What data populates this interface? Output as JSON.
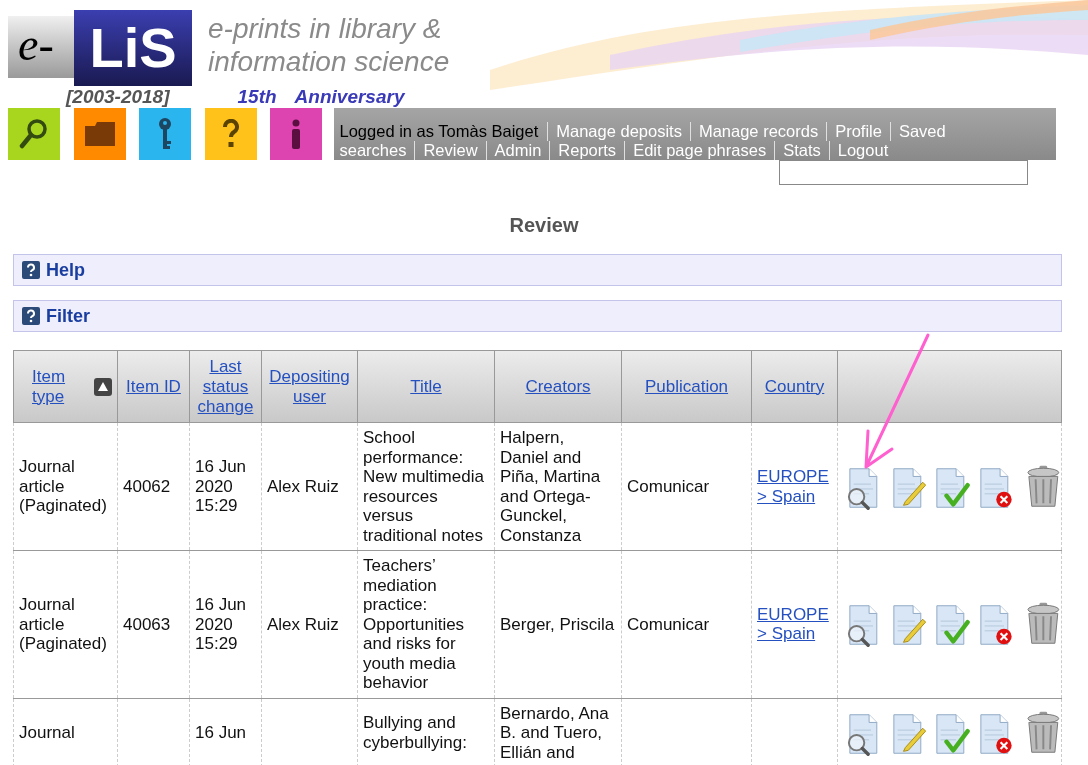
{
  "logo": {
    "prefix": "e-",
    "name": "LiS",
    "years": "[2003-2018]",
    "tagline": [
      "e-prints in library &",
      "information science"
    ],
    "anniversary": [
      "15th",
      "Anniversary"
    ]
  },
  "toolbar": [
    {
      "kind": "search",
      "color": "#a8d61e"
    },
    {
      "kind": "folder",
      "color": "#ff8a00"
    },
    {
      "kind": "key",
      "color": "#2bb5ee"
    },
    {
      "kind": "help",
      "color": "#ffc21a"
    },
    {
      "kind": "info",
      "color": "#dd44b0"
    }
  ],
  "user_nav": {
    "logged_in": "Logged in as Tomàs Baiget",
    "lines": [
      [
        "Manage deposits",
        "Manage records",
        "Profile",
        "Saved"
      ],
      [
        "searches",
        "Review",
        "Admin",
        "Reports",
        "Edit page phrases",
        "Stats",
        "Logout"
      ]
    ]
  },
  "page_title": "Review",
  "sections": [
    {
      "label": "Help"
    },
    {
      "label": "Filter"
    }
  ],
  "table": {
    "columns": [
      {
        "label": "Item type",
        "sorted": true
      },
      {
        "label": "Item ID",
        "sorted": false
      },
      {
        "label": "Last status change",
        "sorted": false
      },
      {
        "label": "Depositing user",
        "sorted": false
      },
      {
        "label": "Title",
        "sorted": false
      },
      {
        "label": "Creators",
        "sorted": false
      },
      {
        "label": "Publication",
        "sorted": false
      },
      {
        "label": "Country",
        "sorted": false
      }
    ],
    "rows": [
      {
        "item_type": "Journal article (Paginated)",
        "item_id": "40062",
        "last_change": "16 Jun 2020 15:29",
        "depositor": "Alex Ruiz",
        "title": "School performance: New multimedia resources versus traditional notes",
        "creators": "Halpern, Daniel and Piña, Martina and Ortega-Gunckel, Constanza",
        "publication": "Comunicar",
        "country": "EUROPE > Spain"
      },
      {
        "item_type": "Journal article (Paginated)",
        "item_id": "40063",
        "last_change": "16 Jun 2020 15:29",
        "depositor": "Alex Ruiz",
        "title": "Teachers’ mediation practice: Opportunities and risks for youth media behavior",
        "creators": "Berger, Priscila",
        "publication": "Comunicar",
        "country": "EUROPE > Spain"
      },
      {
        "item_type": "Journal",
        "last_change": "16 Jun",
        "title": "Bullying and cyberbullying:",
        "creators": "Bernardo, Ana B. and Tuero, Ellián and"
      }
    ]
  }
}
